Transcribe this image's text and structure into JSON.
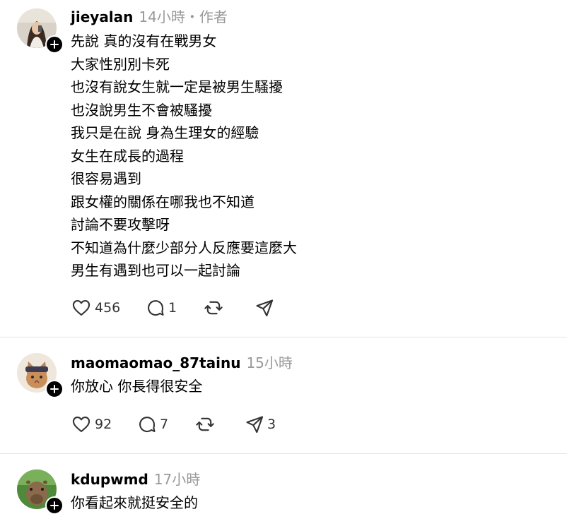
{
  "posts": [
    {
      "username": "jieyalan",
      "time": "14小時",
      "author_tag": "・作者",
      "lines": [
        "先說 真的沒有在戰男女",
        "大家性別別卡死",
        "也沒有說女生就一定是被男生騷擾",
        "也沒說男生不會被騷擾",
        "我只是在說 身為生理女的經驗",
        "女生在成長的過程",
        "很容易遇到",
        "跟女權的關係在哪我也不知道",
        "討論不要攻擊呀",
        "不知道為什麼少部分人反應要這麼大",
        "男生有遇到也可以一起討論"
      ],
      "likes": "456",
      "replies": "1",
      "reposts": "",
      "shares": ""
    },
    {
      "username": "maomaomao_87tainu",
      "time": "15小時",
      "lines": [
        "你放心 你長得很安全"
      ],
      "likes": "92",
      "replies": "7",
      "reposts": "",
      "shares": "3"
    },
    {
      "username": "kdupwmd",
      "time": "17小時",
      "lines": [
        "你看起來就挺安全的"
      ]
    }
  ],
  "icons": {
    "like": "heart-icon",
    "reply": "comment-icon",
    "repost": "repost-icon",
    "share": "share-icon",
    "follow": "plus-icon"
  }
}
